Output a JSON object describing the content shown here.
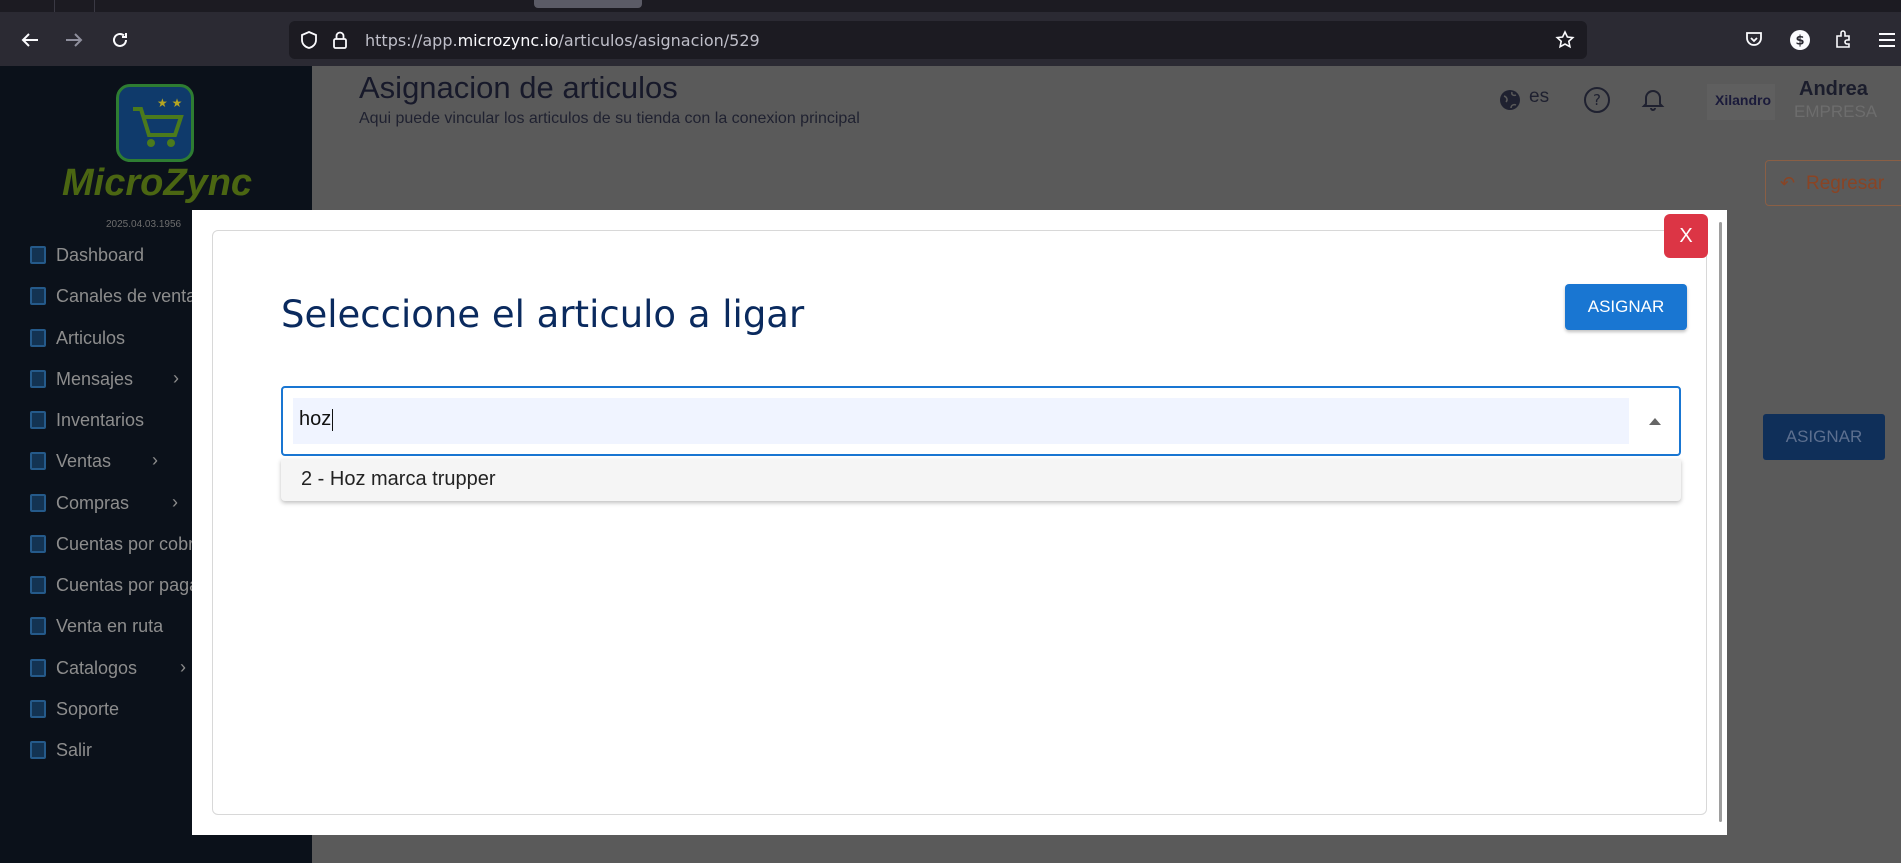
{
  "browser": {
    "url_prefix": "https://app.",
    "url_host": "microzync.io",
    "url_path": "/articulos/asignacion/529"
  },
  "sidebar": {
    "brand": "MicroZync",
    "version": "2025.04.03.1956",
    "items": [
      {
        "label": "Dashboard"
      },
      {
        "label": "Canales de venta"
      },
      {
        "label": "Articulos"
      },
      {
        "label": "Mensajes"
      },
      {
        "label": "Inventarios"
      },
      {
        "label": "Ventas"
      },
      {
        "label": "Compras"
      },
      {
        "label": "Cuentas por cobrar"
      },
      {
        "label": "Cuentas por pagar"
      },
      {
        "label": "Venta en ruta"
      },
      {
        "label": "Catalogos"
      },
      {
        "label": "Soporte"
      },
      {
        "label": "Salir"
      }
    ]
  },
  "header": {
    "title": "Asignacion de articulos",
    "subtitle": "Aqui puede vincular los articulos de su tienda con la conexion principal",
    "language": "es",
    "company_logo": "Xilandro",
    "user_name": "Andrea",
    "user_role": "EMPRESA",
    "back_label": "Regresar",
    "assign_label": "ASIGNAR"
  },
  "modal": {
    "close_label": "X",
    "title": "Seleccione el articulo a ligar",
    "assign_label": "ASIGNAR",
    "search_value": "hoz",
    "options": [
      {
        "label": "2 - Hoz marca trupper"
      }
    ]
  },
  "colors": {
    "primary": "#1976d2",
    "danger": "#dc3545",
    "title": "#0a2a5e"
  }
}
